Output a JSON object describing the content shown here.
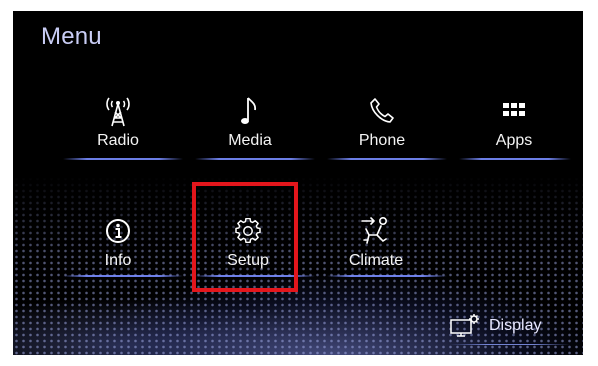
{
  "screen": {
    "title": "Menu"
  },
  "menu": {
    "items": [
      {
        "label": "Radio",
        "icon": "radio-tower-icon"
      },
      {
        "label": "Media",
        "icon": "music-note-icon"
      },
      {
        "label": "Phone",
        "icon": "phone-icon"
      },
      {
        "label": "Apps",
        "icon": "apps-grid-icon"
      },
      {
        "label": "Info",
        "icon": "info-icon"
      },
      {
        "label": "Setup",
        "icon": "gear-icon"
      },
      {
        "label": "Climate",
        "icon": "climate-seat-icon"
      }
    ]
  },
  "display": {
    "label": "Display",
    "icon": "display-settings-icon"
  },
  "colors": {
    "accent": "#7f8cff",
    "highlight": "#e3161c",
    "title": "#c9cdf5",
    "background": "#000000"
  }
}
